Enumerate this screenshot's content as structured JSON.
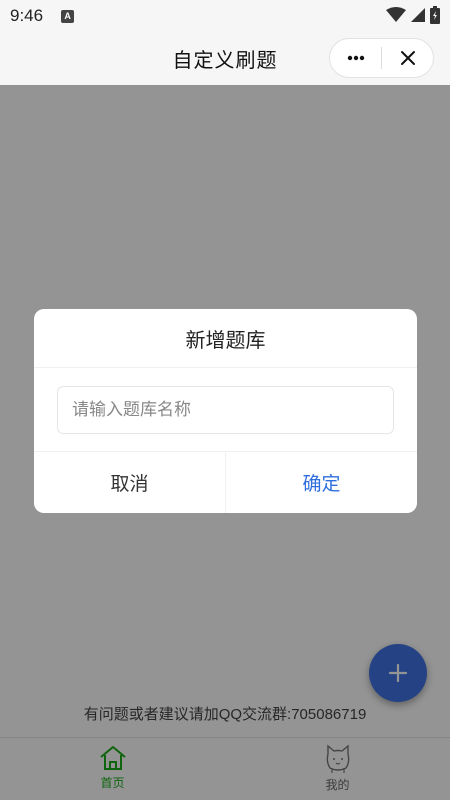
{
  "status_bar": {
    "time": "9:46",
    "notification_badge": "A"
  },
  "nav": {
    "title": "自定义刷题"
  },
  "footer": {
    "text": "有问题或者建议请加QQ交流群:705086719"
  },
  "tabs": [
    {
      "label": "首页",
      "icon": "home-icon",
      "active": true
    },
    {
      "label": "我的",
      "icon": "cat-face-icon",
      "active": false
    }
  ],
  "dialog": {
    "title": "新增题库",
    "input_placeholder": "请输入题库名称",
    "input_value": "",
    "cancel_label": "取消",
    "confirm_label": "确定"
  },
  "colors": {
    "accent_blue": "#2f6fde",
    "fab_blue": "#3f73e4",
    "tab_active_green": "#1aad19",
    "mask": "rgba(0,0,0,0.42)"
  }
}
